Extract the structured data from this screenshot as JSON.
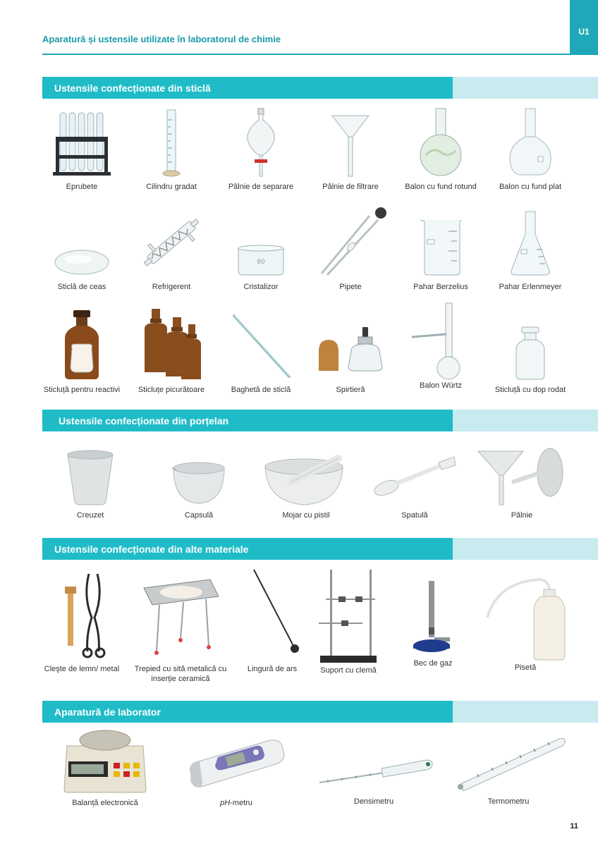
{
  "header": {
    "title": "Aparatură și ustensile utilizate în laboratorul de chimie",
    "unit": "U1"
  },
  "sections": {
    "glass": "Ustensile confecționate din sticlă",
    "porcelain": "Ustensile confecționate din porțelan",
    "other": "Ustensile confecționate din alte materiale",
    "apparatus": "Aparatură de laborator"
  },
  "glass_items": {
    "i1": {
      "label": "Eprubete",
      "icon": "test-tubes-rack"
    },
    "i2": {
      "label": "Cilindru gradat",
      "icon": "graduated-cylinder"
    },
    "i3": {
      "label": "Pâlnie de separare",
      "icon": "separatory-funnel"
    },
    "i4": {
      "label": "Pâlnie de filtrare",
      "icon": "filter-funnel"
    },
    "i5": {
      "label": "Balon cu fund rotund",
      "icon": "round-bottom-flask"
    },
    "i6": {
      "label": "Balon cu fund plat",
      "icon": "flat-bottom-flask"
    },
    "i7": {
      "label": "Sticlă de ceas",
      "icon": "watch-glass"
    },
    "i8": {
      "label": "Refrigerent",
      "icon": "condenser"
    },
    "i9": {
      "label": "Cristalizor",
      "icon": "crystallizer",
      "mark": "80"
    },
    "i10": {
      "label": "Pipete",
      "icon": "pipettes"
    },
    "i11": {
      "label": "Pahar Berzelius",
      "icon": "beaker"
    },
    "i12": {
      "label": "Pahar Erlenmeyer",
      "icon": "erlenmeyer-flask"
    },
    "i13": {
      "label": "Sticluță pentru reactivi",
      "icon": "reagent-bottle"
    },
    "i14": {
      "label": "Sticluțe picurătoare",
      "icon": "dropper-bottles"
    },
    "i15": {
      "label": "Baghetă de sticlă",
      "icon": "glass-rod"
    },
    "i16": {
      "label": "Spirtieră",
      "icon": "spirit-lamp"
    },
    "i17": {
      "label": "Balon Würtz",
      "icon": "wurtz-flask"
    },
    "i18": {
      "label": "Sticluță cu dop rodat",
      "icon": "ground-stopper-bottle"
    }
  },
  "porcelain_items": {
    "p1": {
      "label": "Creuzet",
      "icon": "crucible"
    },
    "p2": {
      "label": "Capsulă",
      "icon": "evaporating-dish"
    },
    "p3": {
      "label": "Mojar cu pistil",
      "icon": "mortar-pestle"
    },
    "p4": {
      "label": "Spatulă",
      "icon": "spatula"
    },
    "p5": {
      "label": "Pâlnie",
      "icon": "porcelain-funnel"
    }
  },
  "other_items": {
    "o1": {
      "label": "Cleşte de lemn/ metal",
      "icon": "tongs"
    },
    "o2": {
      "label": "Trepied cu sită metalică cu inserție ceramică",
      "icon": "tripod-gauze"
    },
    "o3": {
      "label": "Lingură de ars",
      "icon": "deflagrating-spoon"
    },
    "o4": {
      "label": "Suport cu clemă",
      "icon": "retort-stand"
    },
    "o5": {
      "label": "Bec de gaz",
      "icon": "bunsen-burner"
    },
    "o6": {
      "label": "Pisetă",
      "icon": "wash-bottle"
    }
  },
  "apparatus_items": {
    "a1": {
      "label": "Balanță electronică",
      "icon": "electronic-balance"
    },
    "a2": {
      "label_prefix": "pH",
      "label_suffix": "-metru",
      "icon": "ph-meter"
    },
    "a3": {
      "label": "Densimetru",
      "icon": "hydrometer"
    },
    "a4": {
      "label": "Termometru",
      "icon": "thermometer"
    }
  },
  "page_number": "11",
  "colors": {
    "accent": "#1fbcc8",
    "accent_light": "#c8ebf0",
    "header_text": "#1a9aaa"
  }
}
